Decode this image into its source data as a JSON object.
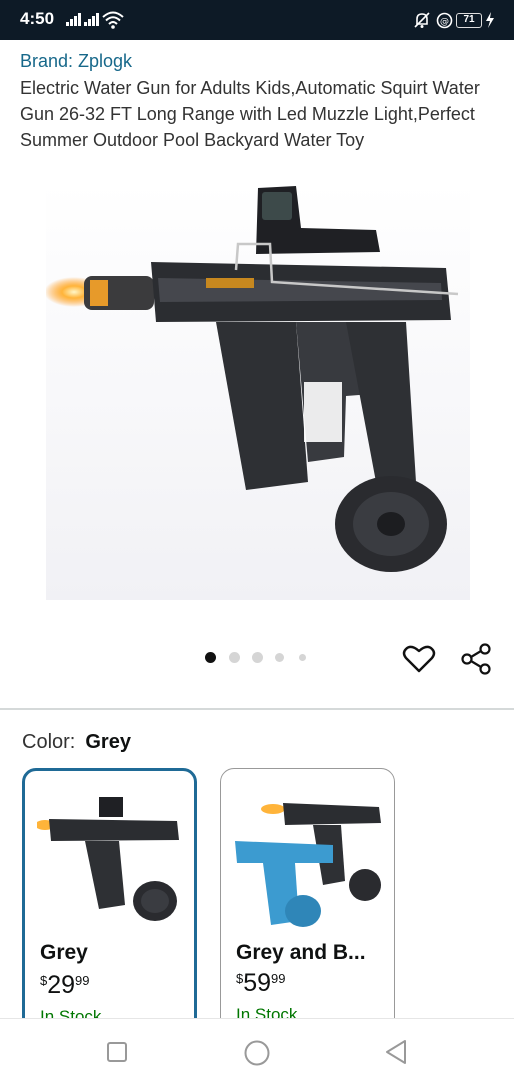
{
  "status_bar": {
    "time": "4:50",
    "battery": "71"
  },
  "product": {
    "brand": "Brand: Zplogk",
    "title": "Electric Water Gun for Adults Kids,Automatic Squirt Water Gun 26-32 FT Long Range with Led Muzzle Light,Perfect Summer Outdoor Pool Backyard Water Toy"
  },
  "carousel": {
    "total_images": 5,
    "active_index": 0
  },
  "icons": {
    "wishlist": "heart-icon",
    "share": "share-icon"
  },
  "variation": {
    "label": "Color:",
    "selected": "Grey",
    "options": [
      {
        "name": "Grey",
        "currency": "$",
        "price_whole": "29",
        "price_fraction": "99",
        "stock": "In Stock",
        "selected": true
      },
      {
        "name": "Grey and B...",
        "currency": "$",
        "price_whole": "59",
        "price_fraction": "99",
        "stock": "In Stock",
        "selected": false
      }
    ]
  },
  "colors": {
    "status_bar_bg": "#0d1a26",
    "link": "#17688a",
    "selected_border": "#1f6a96",
    "in_stock": "#007600"
  }
}
